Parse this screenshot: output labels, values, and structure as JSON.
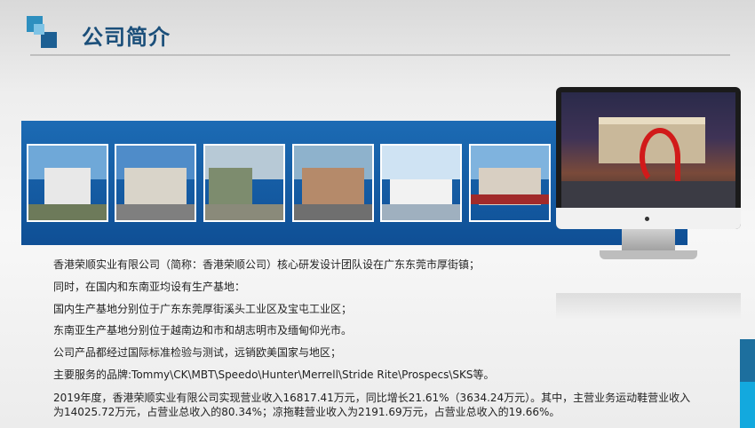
{
  "header": {
    "title": "公司简介"
  },
  "photos": [
    "factory-photo-1",
    "factory-photo-2",
    "factory-photo-3",
    "factory-photo-4",
    "factory-photo-5",
    "factory-photo-6"
  ],
  "monitor": {
    "image": "night-plaza-sculpture"
  },
  "body": {
    "line1": "香港荣顺实业有限公司（简称：香港荣顺公司）核心研发设计团队设在广东东莞市厚街镇；",
    "line2": "同时，在国内和东南亚均设有生产基地：",
    "line3": "国内生产基地分别位于广东东莞厚街溪头工业区及宝屯工业区；",
    "line4": "东南亚生产基地分别位于越南边和市和胡志明市及缅甸仰光市。",
    "line5": "公司产品都经过国际标准检验与测试，远销欧美国家与地区；",
    "line6": "主要服务的品牌:Tommy\\CK\\MBT\\Speedo\\Hunter\\Merrell\\Stride Rite\\Prospecs\\SKS等。",
    "line7": "2019年度，香港荣顺实业有限公司实现营业收入16817.41万元，同比增长21.61%（3634.24万元）。其中，主营业务运动鞋营业收入为14025.72万元，占营业总收入的80.34%；凉拖鞋营业收入为2191.69万元，占营业总收入的19.66%。"
  },
  "colors": {
    "accent": "#1b4f7a",
    "band": "#0f4f95",
    "corner_light": "#13a9de",
    "corner_dark": "#1d6f9e"
  }
}
